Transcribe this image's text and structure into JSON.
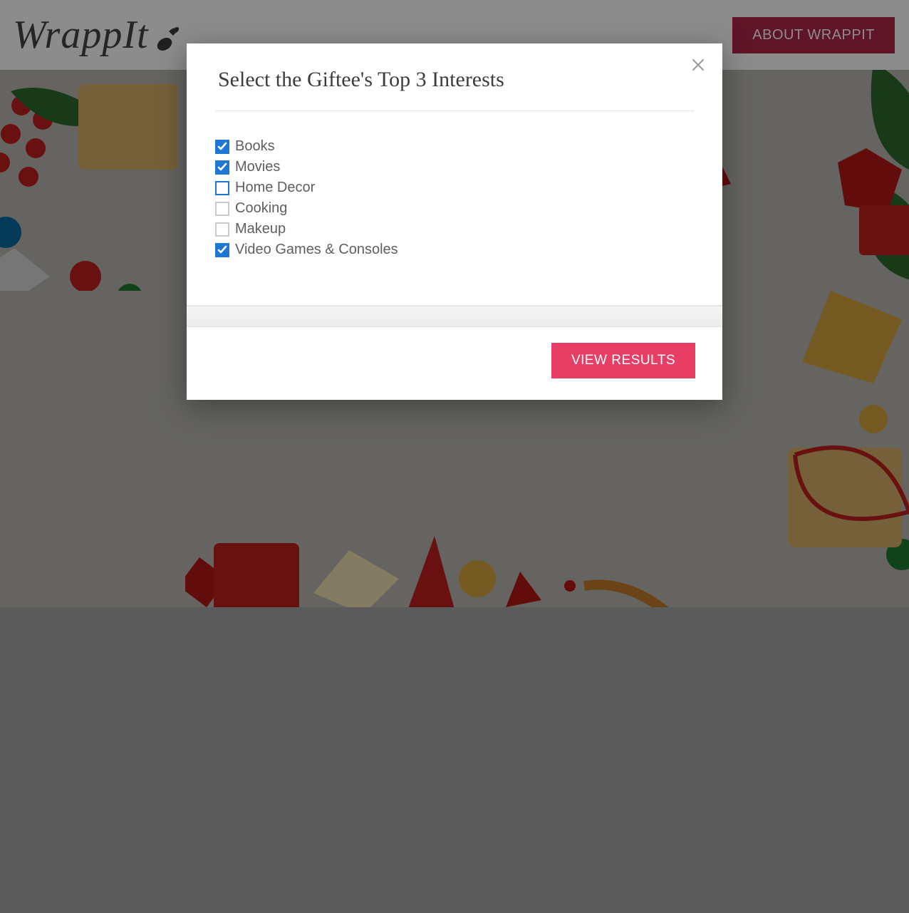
{
  "header": {
    "logo_text": "WrappIt",
    "about_button": "ABOUT WRAPPIT"
  },
  "modal": {
    "title": "Select the Giftee's Top 3 Interests",
    "interests": [
      {
        "label": "Books",
        "checked": true,
        "focused": false
      },
      {
        "label": "Movies",
        "checked": true,
        "focused": false
      },
      {
        "label": "Home Decor",
        "checked": false,
        "focused": true
      },
      {
        "label": "Cooking",
        "checked": false,
        "focused": false
      },
      {
        "label": "Makeup",
        "checked": false,
        "focused": false
      },
      {
        "label": "Video Games & Consoles",
        "checked": true,
        "focused": false
      }
    ],
    "view_results_button": "VIEW RESULTS"
  },
  "colors": {
    "accent_pink": "#e83e65",
    "accent_pink_dark": "#b02648",
    "checkbox_blue": "#1f77d4"
  }
}
